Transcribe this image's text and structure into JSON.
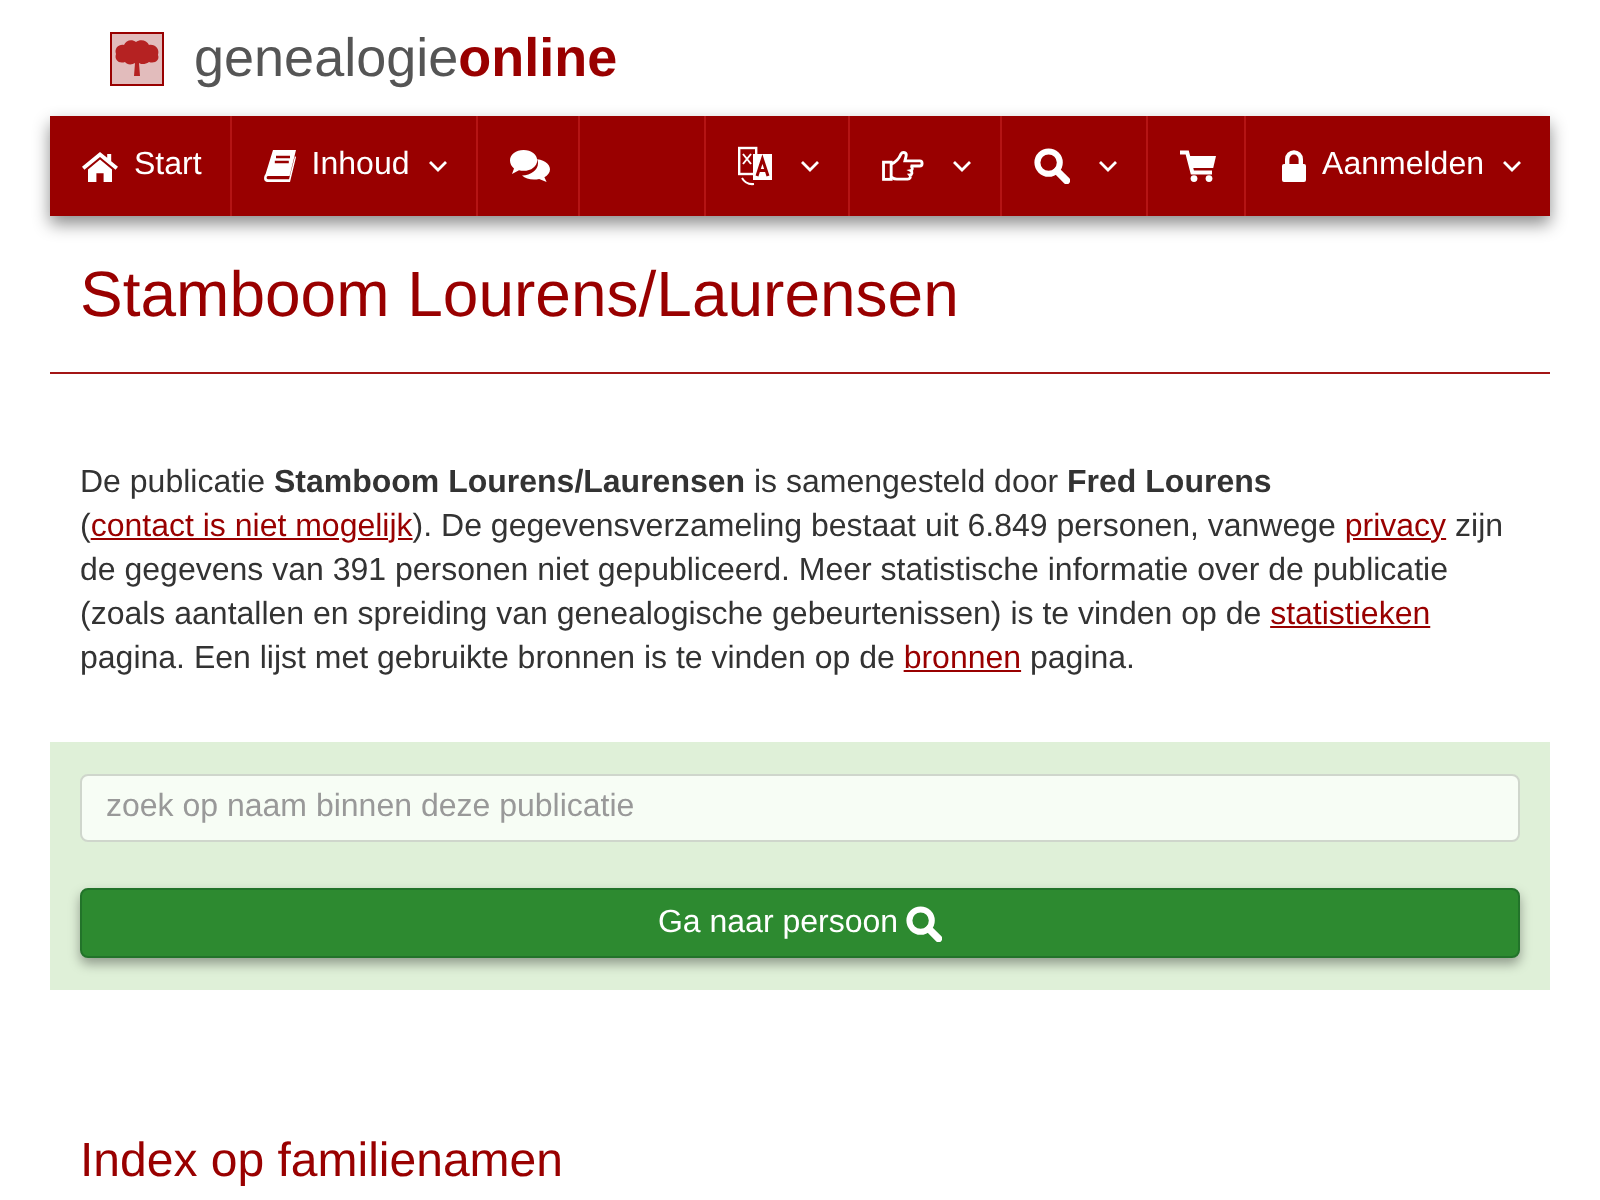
{
  "logo": {
    "text": "genealogie**online**"
  },
  "nav": {
    "left_items": [
      {
        "label": "Start",
        "dropdown": false
      },
      {
        "label": "Inhoud",
        "dropdown": true
      },
      {
        "dropdown": false
      }
    ],
    "right_items": [
      {
        "dropdown": true
      },
      {
        "dropdown": true
      },
      {
        "dropdown": true
      },
      {
        "dropdown": false
      },
      {
        "label": "Aanmelden",
        "dropdown": true
      }
    ]
  },
  "title": "Stamboom Lourens/Laurensen",
  "intro": [
    {
      "kind": "text",
      "text": "De publicatie **Stamboom Lourens/Laurensen** is samengesteld door **Fred Lourens** ("
    },
    {
      "kind": "link",
      "text": "contact is niet mogelijk"
    },
    {
      "kind": "text",
      "text": "). De gegevensverzameling bestaat uit 6.849 personen, vanwege "
    },
    {
      "kind": "link",
      "text": "privacy"
    },
    {
      "kind": "text",
      "text": " zijn de gegevens van 391 personen niet gepubliceerd. Meer statistische informatie over de publicatie (zoals aantallen en spreiding van genealogische gebeurtenissen) is te vinden op de "
    },
    {
      "kind": "link",
      "text": "statistieken"
    },
    {
      "kind": "text",
      "text": " pagina. Een lijst met gebruikte bronnen is te vinden op de "
    },
    {
      "kind": "link",
      "text": "bronnen"
    },
    {
      "kind": "text",
      "text": " pagina."
    }
  ],
  "search": {
    "placeholder": "zoek op naam binnen deze publicatie",
    "button": "Ga naar persoon"
  },
  "section_heading": "Index op familienamen"
}
